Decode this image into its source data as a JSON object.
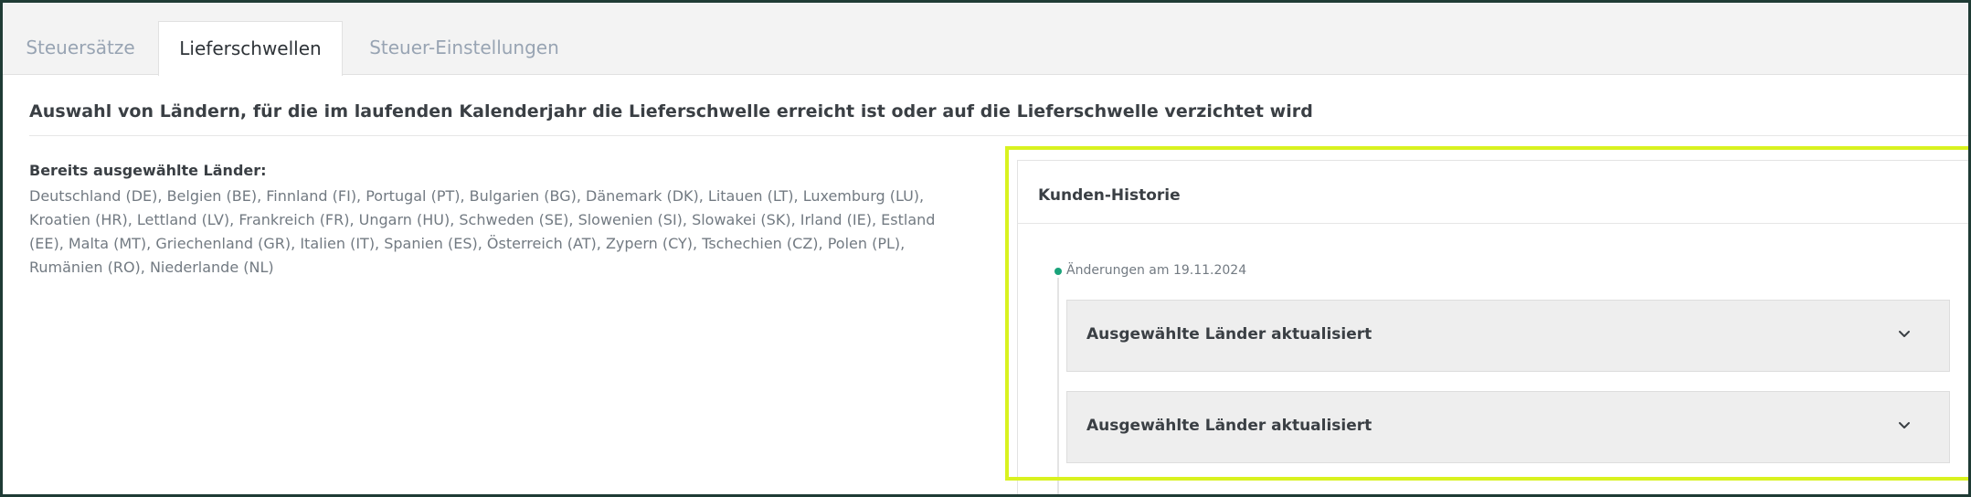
{
  "tabs": [
    {
      "label": "Steuersätze",
      "active": false
    },
    {
      "label": "Lieferschwellen",
      "active": true
    },
    {
      "label": "Steuer-Einstellungen",
      "active": false
    }
  ],
  "main": {
    "heading": "Auswahl von Ländern, für die im laufenden Kalenderjahr die Lieferschwelle erreicht ist oder auf die Lieferschwelle verzichtet wird",
    "selected_label": "Bereits ausgewählte Länder:",
    "selected_countries": "Deutschland (DE), Belgien (BE), Finnland (FI), Portugal (PT), Bulgarien (BG), Dänemark (DK), Litauen (LT), Luxemburg (LU), Kroatien (HR), Lettland (LV), Frankreich (FR), Ungarn (HU), Schweden (SE), Slowenien (SI), Slowakei (SK), Irland (IE), Estland (EE), Malta (MT), Griechenland (GR), Italien (IT), Spanien (ES), Österreich (AT), Zypern (CY), Tschechien (CZ), Polen (PL), Rumänien (RO), Niederlande (NL)"
  },
  "history": {
    "title": "Kunden-Historie",
    "date_label": "Änderungen am 19.11.2024",
    "entries": [
      {
        "label": "Ausgewählte Länder aktualisiert",
        "icon": "chevron-down-icon"
      },
      {
        "label": "Ausgewählte Länder aktualisiert",
        "icon": "chevron-down-icon"
      }
    ]
  },
  "colors": {
    "accent_green": "#1aa37a",
    "highlight": "#d9f21f",
    "frame": "#1f3b35"
  }
}
